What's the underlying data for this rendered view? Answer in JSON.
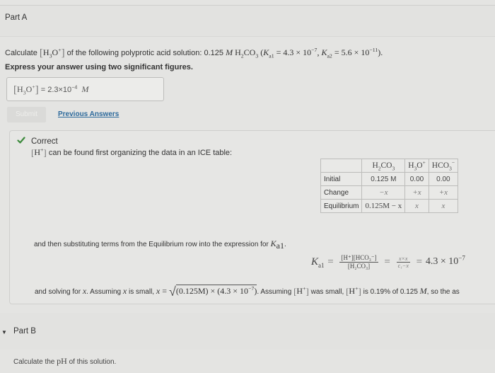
{
  "part_a": {
    "title": "Part A",
    "question_prefix": "Calculate ",
    "question_species": "H",
    "question_species_sub": "3",
    "question_species_tail": "O",
    "question_species_sup": "+",
    "question_mid": " of the following polyprotic acid solution: 0.125 ",
    "question_unit": "M",
    "question_acid": " H",
    "question_acid_sub1": "2",
    "question_acid_mid": "CO",
    "question_acid_sub2": "3",
    "question_ka1_open": " (",
    "question_ka1_label": "K",
    "question_ka1_sub": "a1",
    "question_ka1_value": " = 4.3 × 10",
    "question_ka1_exp": "−7",
    "question_ka2_sep": ", ",
    "question_ka2_label": "K",
    "question_ka2_sub": "a2",
    "question_ka2_value": " = 5.6 × 10",
    "question_ka2_exp": "−11",
    "question_close": ").",
    "instruction": "Express your answer using two significant figures.",
    "answer": {
      "label_species": "H",
      "label_sub": "3",
      "label_tail": "O",
      "label_sup": "+",
      "equals": " = ",
      "value_mantissa": "2.3×10",
      "value_exp": "−4",
      "unit": "M"
    },
    "submit_label": "Submit",
    "previous_answers_label": "Previous Answers"
  },
  "feedback": {
    "status": "Correct",
    "icon": "check-icon",
    "status_color": "#3c8a3c",
    "intro_species": "H",
    "intro_sup": "+",
    "intro_text": " can be found first organizing the data in an ICE table:",
    "ice_table": {
      "headers": [
        {
          "main": "H",
          "sub": "2",
          "tail": "CO",
          "sub2": "3",
          "sup": ""
        },
        {
          "main": "H",
          "sub": "3",
          "tail": "O",
          "sub2": "",
          "sup": "+"
        },
        {
          "main": "HCO",
          "sub": "3",
          "tail": "",
          "sub2": "",
          "sup": "−"
        }
      ],
      "rows": [
        {
          "label": "Initial",
          "cells": [
            "0.125 M",
            "0.00",
            "0.00"
          ]
        },
        {
          "label": "Change",
          "cells": [
            "−x",
            "+x",
            "+x"
          ]
        },
        {
          "label": "Equilibrium",
          "cells": [
            "0.125M − x",
            "x",
            "x"
          ]
        }
      ]
    },
    "substitution_text": "and then substituting terms from the Equilibrium row into the expression for ",
    "substitution_k": "K",
    "substitution_k_sub": "a1",
    "substitution_end": ".",
    "ka_equation": {
      "lhs": "K",
      "lhs_sub": "a1",
      "frac1_num": "[H⁺][HCO₃⁻]",
      "frac1_den": "[H₂CO₃]",
      "frac2_num": "x×x",
      "frac2_den": "c₁−x",
      "rhs_mantissa": "4.3 × 10",
      "rhs_exp": "−7"
    },
    "solve": {
      "text1": "and solving for ",
      "var": "x",
      "text2": ".  Assuming ",
      "var2": "x",
      "text3": " is small,  ",
      "var3": "x",
      "eq": " = ",
      "radicand": "(0.125M) × (4.3 × 10",
      "radicand_exp": "−7",
      "radicand_close": ")",
      "text4": ". Assuming ",
      "h_species": "H",
      "h_sup": "+",
      "text5": " was small, ",
      "text6": " is 0.19% of 0.125 ",
      "unit": "M",
      "text7": ", so the as"
    }
  },
  "part_b": {
    "title": "Part B",
    "expand_icon": "caret-down-icon",
    "question_prefix": "Calculate the ",
    "question_ph": "pH",
    "question_suffix": " of this solution."
  }
}
